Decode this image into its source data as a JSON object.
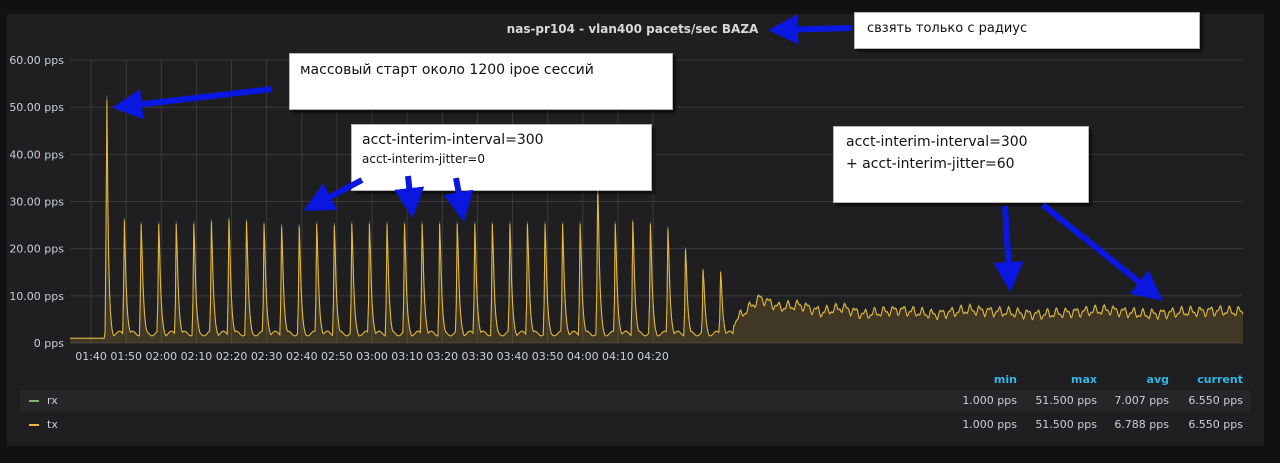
{
  "panel": {
    "title": "nas-pr104 - vlan400 pacets/sec BAZA"
  },
  "chart_data": {
    "type": "area",
    "title": "nas-pr104 - vlan400 pacets/sec BAZA",
    "ylabel": "",
    "xlabel": "",
    "ylim": [
      0,
      60
    ],
    "y_ticks": [
      "0 pps",
      "10.00 pps",
      "20.00 pps",
      "30.00 pps",
      "40.00 pps",
      "50.00 pps",
      "60.00 pps"
    ],
    "x_ticks": [
      "01:40",
      "01:50",
      "02:00",
      "02:10",
      "02:20",
      "02:30",
      "02:40",
      "02:50",
      "03:00",
      "03:10",
      "03:20",
      "03:30",
      "03:40",
      "03:50",
      "04:00",
      "04:10",
      "04:20"
    ],
    "x_range_minutes": [
      94,
      428
    ],
    "grid": true,
    "legend_position": "bottom",
    "baseline": 1.0,
    "massive_start": {
      "minute": 104.5,
      "value": 51.5
    },
    "spike_minutes": [
      104.5,
      109.5,
      114.3,
      119.3,
      124.3,
      129.3,
      134.3,
      139.3,
      144.3,
      149.3,
      154.3,
      159.3,
      164.3,
      169.3,
      174.3,
      179.3,
      184.3,
      189.3,
      194.3,
      199.3,
      204.3,
      209.3,
      214.3,
      219.3,
      224.3,
      229.3,
      234.3,
      239.3,
      244.3,
      249.3,
      254.3,
      259.3,
      264.3,
      269.3,
      274.3,
      279.3
    ],
    "spike_values": [
      51.5,
      26.0,
      26.0,
      26.0,
      26.0,
      26.0,
      26.5,
      27.0,
      26.5,
      26.0,
      25.5,
      25.5,
      26.0,
      25.8,
      26.0,
      26.0,
      26.0,
      26.0,
      26.0,
      26.0,
      26.0,
      26.0,
      26.0,
      26.0,
      26.0,
      26.0,
      26.0,
      26.0,
      34.5,
      26.0,
      26.5,
      26.0,
      25.0,
      20.5,
      16.0,
      15.5
    ],
    "secondary_peaks": [
      {
        "minute": 106.5,
        "value": 14.0
      },
      {
        "minute": 111.5,
        "value": 12.0
      },
      {
        "minute": 276.5,
        "value": 15.0
      },
      {
        "minute": 281.5,
        "value": 12.5
      }
    ],
    "spike_period_minutes": 5,
    "jitter_start_minute": 283,
    "jitter_phase_level": 6.0,
    "jitter_phase_points": [
      {
        "minute": 290.5,
        "value": 9.5
      },
      {
        "minute": 296,
        "value": 7.5
      },
      {
        "minute": 302,
        "value": 8.0
      },
      {
        "minute": 308,
        "value": 6.5
      },
      {
        "minute": 314,
        "value": 7.5
      },
      {
        "minute": 320,
        "value": 6.0
      },
      {
        "minute": 330,
        "value": 7.0
      },
      {
        "minute": 340,
        "value": 6.0
      },
      {
        "minute": 350,
        "value": 7.0
      },
      {
        "minute": 360,
        "value": 6.5
      },
      {
        "minute": 370,
        "value": 6.0
      },
      {
        "minute": 380,
        "value": 6.5
      },
      {
        "minute": 390,
        "value": 7.0
      },
      {
        "minute": 400,
        "value": 6.0
      },
      {
        "minute": 410,
        "value": 6.5
      },
      {
        "minute": 420,
        "value": 6.8
      },
      {
        "minute": 428,
        "value": 6.55
      }
    ],
    "series": [
      {
        "name": "rx",
        "color": "#7eb26d"
      },
      {
        "name": "tx",
        "color": "#eab839"
      }
    ]
  },
  "legend": {
    "headers": {
      "min": "min",
      "max": "max",
      "avg": "avg",
      "current": "current"
    },
    "rows": [
      {
        "name": "rx",
        "color": "#7eb26d",
        "min": "1.000 pps",
        "max": "51.500 pps",
        "avg": "7.007 pps",
        "current": "6.550 pps"
      },
      {
        "name": "tx",
        "color": "#eab839",
        "min": "1.000 pps",
        "max": "51.500 pps",
        "avg": "6.788 pps",
        "current": "6.550 pps"
      }
    ]
  },
  "annotations": {
    "radius": "свзять только с радиус",
    "mass_start": "массовый старт около 1200 ipoe сессий",
    "interim_1": "acct-interim-interval=300",
    "interim_2": "acct-interim-jitter=0",
    "jitter_1": "acct-interim-interval=300",
    "jitter_2": "+ acct-interim-jitter=60"
  },
  "colors": {
    "arrow": "#0a17e0",
    "panel_bg": "#1f1f21",
    "grid": "#3a3a3c",
    "stat_header": "#33b5e5"
  }
}
